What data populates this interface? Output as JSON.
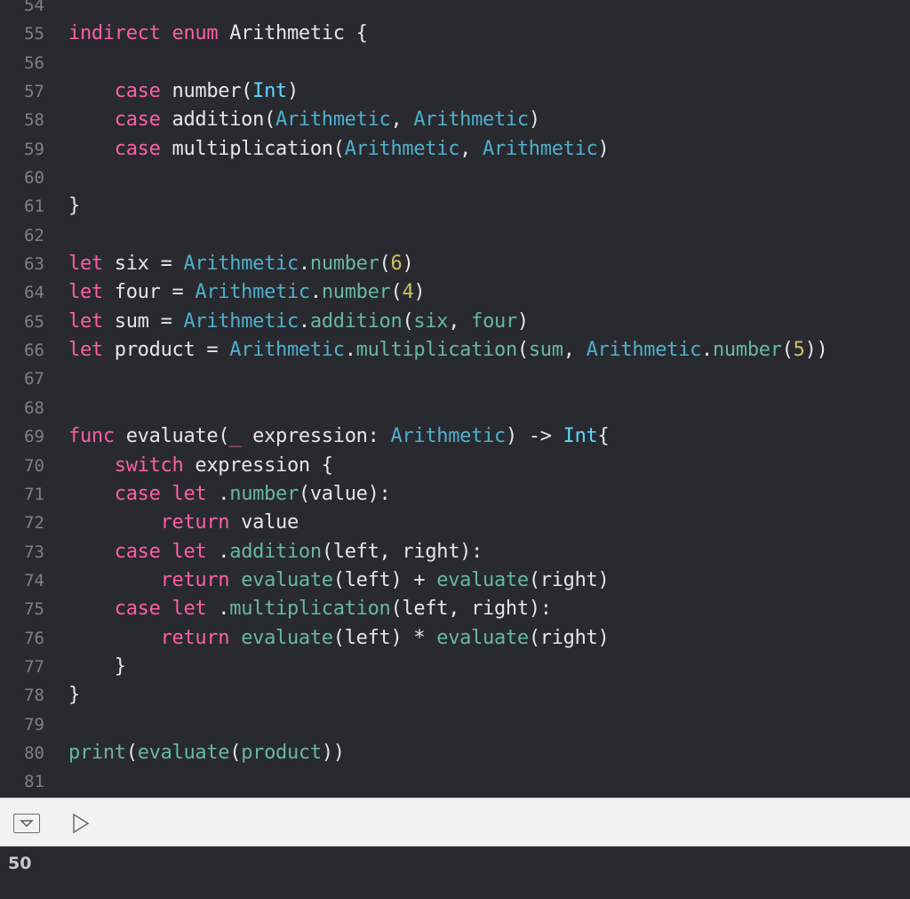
{
  "editor": {
    "lines": [
      {
        "n": "54",
        "tokens": []
      },
      {
        "n": "55",
        "tokens": [
          [
            "kw",
            "indirect"
          ],
          [
            "pl",
            " "
          ],
          [
            "kw",
            "enum"
          ],
          [
            "pl",
            " Arithmetic {"
          ]
        ]
      },
      {
        "n": "56",
        "tokens": []
      },
      {
        "n": "57",
        "tokens": [
          [
            "pl",
            "    "
          ],
          [
            "kw",
            "case"
          ],
          [
            "pl",
            " number("
          ],
          [
            "ty",
            "Int"
          ],
          [
            "pl",
            ")"
          ]
        ]
      },
      {
        "n": "58",
        "tokens": [
          [
            "pl",
            "    "
          ],
          [
            "kw",
            "case"
          ],
          [
            "pl",
            " addition("
          ],
          [
            "tyc",
            "Arithmetic"
          ],
          [
            "pl",
            ", "
          ],
          [
            "tyc",
            "Arithmetic"
          ],
          [
            "pl",
            ")"
          ]
        ]
      },
      {
        "n": "59",
        "tokens": [
          [
            "pl",
            "    "
          ],
          [
            "kw",
            "case"
          ],
          [
            "pl",
            " multiplication("
          ],
          [
            "tyc",
            "Arithmetic"
          ],
          [
            "pl",
            ", "
          ],
          [
            "tyc",
            "Arithmetic"
          ],
          [
            "pl",
            ")"
          ]
        ]
      },
      {
        "n": "60",
        "tokens": []
      },
      {
        "n": "61",
        "tokens": [
          [
            "pl",
            "}"
          ]
        ]
      },
      {
        "n": "62",
        "tokens": []
      },
      {
        "n": "63",
        "tokens": [
          [
            "kw",
            "let"
          ],
          [
            "pl",
            " six = "
          ],
          [
            "tyc",
            "Arithmetic"
          ],
          [
            "pl",
            "."
          ],
          [
            "fn",
            "number"
          ],
          [
            "pl",
            "("
          ],
          [
            "num",
            "6"
          ],
          [
            "pl",
            ")"
          ]
        ]
      },
      {
        "n": "64",
        "tokens": [
          [
            "kw",
            "let"
          ],
          [
            "pl",
            " four = "
          ],
          [
            "tyc",
            "Arithmetic"
          ],
          [
            "pl",
            "."
          ],
          [
            "fn",
            "number"
          ],
          [
            "pl",
            "("
          ],
          [
            "num",
            "4"
          ],
          [
            "pl",
            ")"
          ]
        ]
      },
      {
        "n": "65",
        "tokens": [
          [
            "kw",
            "let"
          ],
          [
            "pl",
            " sum = "
          ],
          [
            "tyc",
            "Arithmetic"
          ],
          [
            "pl",
            "."
          ],
          [
            "fn",
            "addition"
          ],
          [
            "pl",
            "("
          ],
          [
            "fn",
            "six"
          ],
          [
            "pl",
            ", "
          ],
          [
            "fn",
            "four"
          ],
          [
            "pl",
            ")"
          ]
        ]
      },
      {
        "n": "66",
        "tokens": [
          [
            "kw",
            "let"
          ],
          [
            "pl",
            " product = "
          ],
          [
            "tyc",
            "Arithmetic"
          ],
          [
            "pl",
            "."
          ],
          [
            "fn",
            "multiplication"
          ],
          [
            "pl",
            "("
          ],
          [
            "fn",
            "sum"
          ],
          [
            "pl",
            ", "
          ],
          [
            "tyc",
            "Arithmetic"
          ],
          [
            "pl",
            "."
          ],
          [
            "fn",
            "number"
          ],
          [
            "pl",
            "("
          ],
          [
            "num",
            "5"
          ],
          [
            "pl",
            "))"
          ]
        ]
      },
      {
        "n": "67",
        "tokens": []
      },
      {
        "n": "68",
        "tokens": []
      },
      {
        "n": "69",
        "tokens": [
          [
            "kw",
            "func"
          ],
          [
            "pl",
            " evaluate("
          ],
          [
            "kw",
            "_"
          ],
          [
            "pl",
            " expression: "
          ],
          [
            "tyc",
            "Arithmetic"
          ],
          [
            "pl",
            ") -> "
          ],
          [
            "ty",
            "Int"
          ],
          [
            "pl",
            "{"
          ]
        ]
      },
      {
        "n": "70",
        "tokens": [
          [
            "pl",
            "    "
          ],
          [
            "kw",
            "switch"
          ],
          [
            "pl",
            " expression {"
          ]
        ]
      },
      {
        "n": "71",
        "tokens": [
          [
            "pl",
            "    "
          ],
          [
            "kw",
            "case"
          ],
          [
            "pl",
            " "
          ],
          [
            "kw",
            "let"
          ],
          [
            "pl",
            " ."
          ],
          [
            "fn",
            "number"
          ],
          [
            "pl",
            "(value):"
          ]
        ]
      },
      {
        "n": "72",
        "tokens": [
          [
            "pl",
            "        "
          ],
          [
            "kw",
            "return"
          ],
          [
            "pl",
            " value"
          ]
        ]
      },
      {
        "n": "73",
        "tokens": [
          [
            "pl",
            "    "
          ],
          [
            "kw",
            "case"
          ],
          [
            "pl",
            " "
          ],
          [
            "kw",
            "let"
          ],
          [
            "pl",
            " ."
          ],
          [
            "fn",
            "addition"
          ],
          [
            "pl",
            "(left, right):"
          ]
        ]
      },
      {
        "n": "74",
        "tokens": [
          [
            "pl",
            "        "
          ],
          [
            "kw",
            "return"
          ],
          [
            "pl",
            " "
          ],
          [
            "fn",
            "evaluate"
          ],
          [
            "pl",
            "(left) + "
          ],
          [
            "fn",
            "evaluate"
          ],
          [
            "pl",
            "(right)"
          ]
        ]
      },
      {
        "n": "75",
        "tokens": [
          [
            "pl",
            "    "
          ],
          [
            "kw",
            "case"
          ],
          [
            "pl",
            " "
          ],
          [
            "kw",
            "let"
          ],
          [
            "pl",
            " ."
          ],
          [
            "fn",
            "multiplication"
          ],
          [
            "pl",
            "(left, right):"
          ]
        ]
      },
      {
        "n": "76",
        "tokens": [
          [
            "pl",
            "        "
          ],
          [
            "kw",
            "return"
          ],
          [
            "pl",
            " "
          ],
          [
            "fn",
            "evaluate"
          ],
          [
            "pl",
            "(left) * "
          ],
          [
            "fn",
            "evaluate"
          ],
          [
            "pl",
            "(right)"
          ]
        ]
      },
      {
        "n": "77",
        "tokens": [
          [
            "pl",
            "    }"
          ]
        ]
      },
      {
        "n": "78",
        "tokens": [
          [
            "pl",
            "}"
          ]
        ]
      },
      {
        "n": "79",
        "tokens": []
      },
      {
        "n": "80",
        "tokens": [
          [
            "fn",
            "print"
          ],
          [
            "pl",
            "("
          ],
          [
            "fn",
            "evaluate"
          ],
          [
            "pl",
            "("
          ],
          [
            "fn",
            "product"
          ],
          [
            "pl",
            "))"
          ]
        ]
      },
      {
        "n": "81",
        "tokens": []
      }
    ]
  },
  "debug_bar": {
    "toggle_icon": "hide-console-icon",
    "run_icon": "play-icon"
  },
  "console": {
    "output": "50"
  },
  "colors": {
    "keyword": "#fc5fa3",
    "type": "#5dd8ff",
    "project_type": "#4eb0cc",
    "function": "#67b7a4",
    "number": "#d0bf69",
    "plain": "#e6e6e6",
    "background": "#292a30"
  }
}
